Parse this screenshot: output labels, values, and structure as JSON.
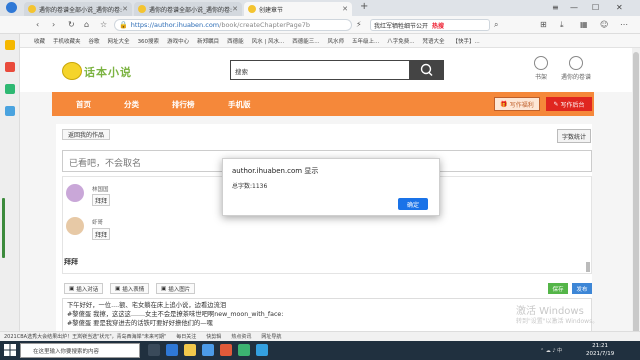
{
  "browser": {
    "tabs": [
      {
        "label": "遇你的卷谱全部小说_遇你的卷:",
        "active": false
      },
      {
        "label": "遇你的卷谱全部小说_遇你的卷:",
        "active": false
      },
      {
        "label": "创建章节",
        "active": true
      }
    ],
    "new_tab": "+",
    "url_host": "https://author.ihuaben.com",
    "url_path": "/book/createChapterPage7b",
    "search_text": "我红军牺牲细节公开",
    "search_tag": "热搜",
    "bookmarks": [
      "收藏",
      "手机收藏夹",
      "谷歌",
      "网址大全",
      "360搜索",
      "游戏中心",
      "新郑瞩目",
      "西德能",
      "风水 | 风水...",
      "西德能三...",
      "风水师",
      "五年级上...",
      "八字免费...",
      "梵语大全",
      "【快手】...",
      "绝命风水..."
    ]
  },
  "site": {
    "logo_text": "话本小说",
    "search_placeholder": "搜索",
    "bookshelf_label": "书架",
    "user_label": "遇你的卷谱",
    "nav": [
      "首页",
      "分类",
      "排行榜",
      "手机版"
    ],
    "write_welfare": "写作福利",
    "write_backend": "写作后台"
  },
  "editor": {
    "back_label": "返回我的作品",
    "wordcount_label": "字数统计",
    "title_placeholder": "已看吧，不会取名",
    "characters": [
      {
        "name": "林国国",
        "bubble": "拜拜"
      },
      {
        "name": "虾哥",
        "bubble": "拜拜"
      }
    ],
    "chat_text": "拜拜",
    "tools": [
      "插入对话",
      "插入表情",
      "插入图片"
    ],
    "save_label": "保存",
    "publish_label": "发布",
    "content_lines": [
      "下午好好，一位....额、宅女躺在床上追小说，边看边流泪",
      "#黎傻蛋 我擦，这这这.......女主不会是撩茶味世吧啊new_moon_with_face:",
      "#黎傻蛋 要是我穿进去的话铁叮要好好撩他们的—嘿"
    ],
    "watermark_line1": "激活 Windows",
    "watermark_line2": "转到\"设置\"以激活 Windows。"
  },
  "alert": {
    "title": "author.ihuaben.com 显示",
    "message": "总字数:1136",
    "ok_label": "确定"
  },
  "statusbar": [
    "2021CBA选秀大会结果出炉！王岚嵚当选\"状元\"，青岛西海岸\"未来可期\"",
    "每日关注",
    "快剪辑",
    "热点资讯",
    "网址导航"
  ],
  "taskbar": {
    "search_placeholder": "在这里输入你要搜索的内容",
    "time": "21:21",
    "date": "2021/7/19"
  },
  "colors": {
    "nav_orange": "#f5883a",
    "backend_red": "#e0261f",
    "save_green": "#54b548",
    "publish_blue": "#3d86d6",
    "ok_blue": "#1a73e8"
  }
}
